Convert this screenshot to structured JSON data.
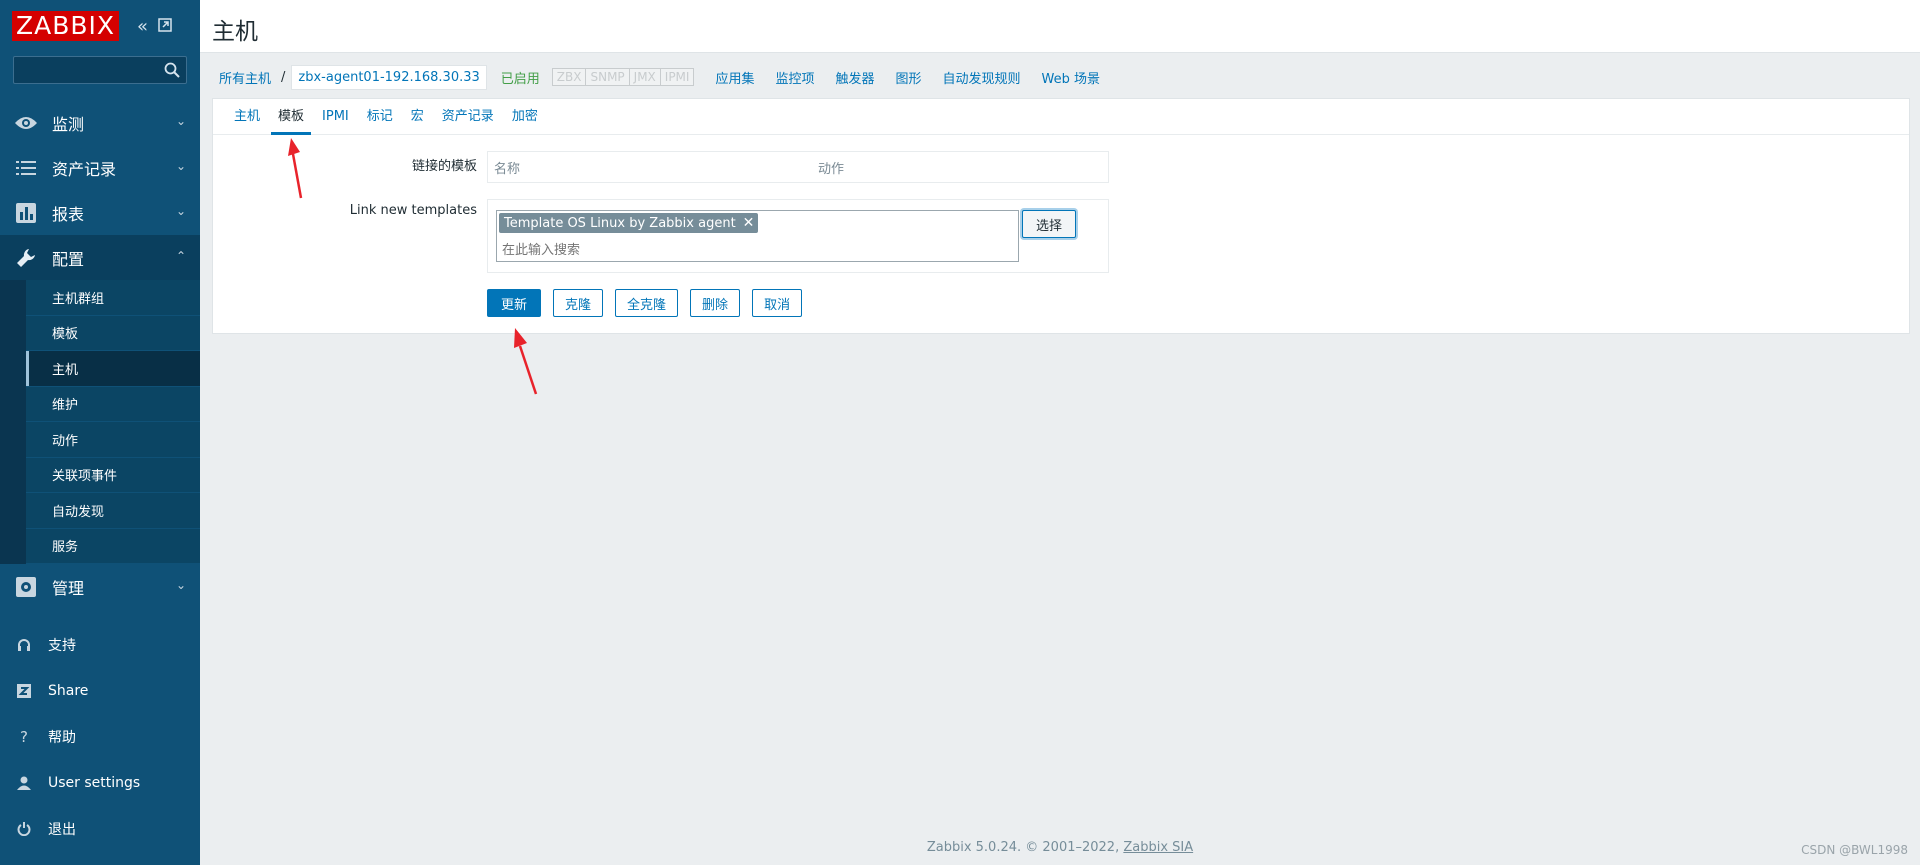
{
  "app": {
    "logo": "ZABBIX"
  },
  "sidebar": {
    "search": {
      "placeholder": "",
      "value": ""
    },
    "menu": [
      {
        "label": "监测",
        "icon": "eye-icon"
      },
      {
        "label": "资产记录",
        "icon": "list-icon"
      },
      {
        "label": "报表",
        "icon": "chart-icon"
      },
      {
        "label": "配置",
        "icon": "wrench-icon"
      }
    ],
    "config_submenu": [
      "主机群组",
      "模板",
      "主机",
      "维护",
      "动作",
      "关联项事件",
      "自动发现",
      "服务"
    ],
    "admin": {
      "label": "管理",
      "icon": "gear-icon"
    },
    "bottom": [
      {
        "label": "支持",
        "icon": "headset-icon"
      },
      {
        "label": "Share",
        "icon": "zabbix-share-icon"
      },
      {
        "label": "帮助",
        "icon": "help-icon"
      },
      {
        "label": "User settings",
        "icon": "user-icon"
      },
      {
        "label": "退出",
        "icon": "power-icon"
      }
    ]
  },
  "header": {
    "title": "主机"
  },
  "host_nav": {
    "all_hosts": "所有主机",
    "separator": "/",
    "current_host": "zbx-agent01-192.168.30.33",
    "status": "已启用",
    "availability": [
      "ZBX",
      "SNMP",
      "JMX",
      "IPMI"
    ],
    "links": [
      "应用集",
      "监控项",
      "触发器",
      "图形",
      "自动发现规则",
      "Web 场景"
    ]
  },
  "tabs": [
    "主机",
    "模板",
    "IPMI",
    "标记",
    "宏",
    "资产记录",
    "加密"
  ],
  "form": {
    "linked_label": "链接的模板",
    "linked_columns": [
      "名称",
      "动作"
    ],
    "new_label": "Link new templates",
    "chip": "Template OS Linux by Zabbix agent",
    "search_placeholder": "在此输入搜索",
    "select_button": "选择",
    "buttons": [
      "更新",
      "克隆",
      "全克隆",
      "删除",
      "取消"
    ]
  },
  "footer": {
    "text": "Zabbix 5.0.24. © 2001–2022, ",
    "link": "Zabbix SIA"
  },
  "watermark": "CSDN @BWL1998",
  "colors": {
    "sidebar": "#0f5177",
    "accent": "#0275b8",
    "enabled": "#429e47",
    "logo": "#d40000",
    "arrow": "#e8232b"
  }
}
